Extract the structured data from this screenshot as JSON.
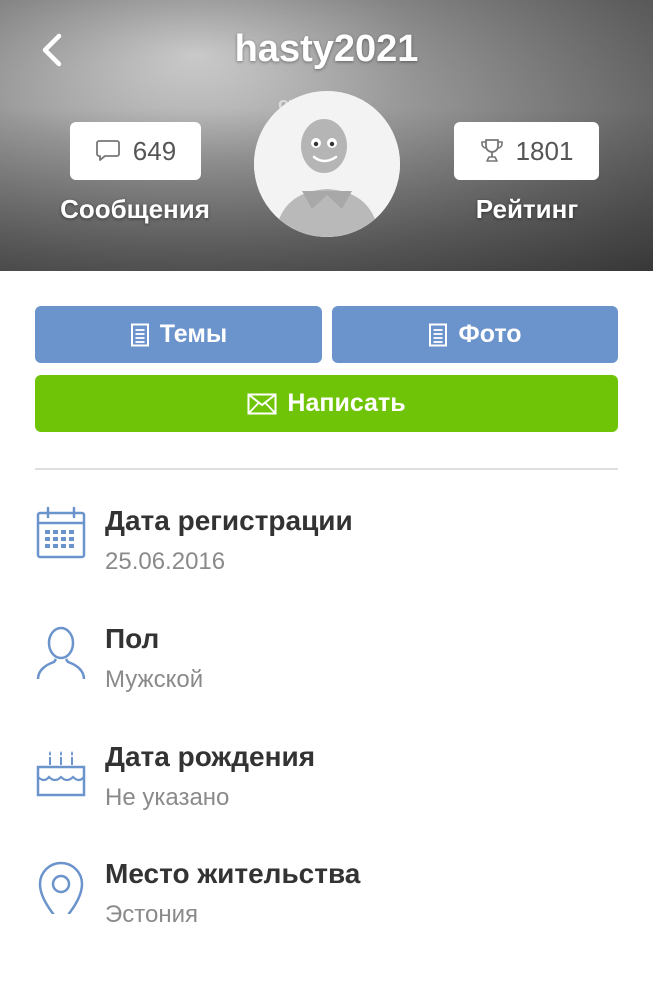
{
  "header": {
    "title": "hasty2021",
    "avatar_watermark": "от Аватар",
    "messages": {
      "count": "649",
      "label": "Сообщения",
      "icon": "chat-bubble-icon"
    },
    "rating": {
      "count": "1801",
      "label": "Рейтинг",
      "icon": "trophy-icon"
    }
  },
  "actions": {
    "topics_label": "Темы",
    "photo_label": "Фото",
    "write_label": "Написать"
  },
  "info": [
    {
      "label": "Дата регистрации",
      "value": "25.06.2016",
      "icon": "calendar-icon"
    },
    {
      "label": "Пол",
      "value": "Мужской",
      "icon": "person-icon"
    },
    {
      "label": "Дата рождения",
      "value": "Не указано",
      "icon": "birthday-cake-icon"
    },
    {
      "label": "Место жительства",
      "value": "Эстония",
      "icon": "location-pin-icon"
    }
  ],
  "colors": {
    "button_blue": "#6b93cc",
    "button_green": "#70c407",
    "icon_blue": "#6b93cc"
  }
}
